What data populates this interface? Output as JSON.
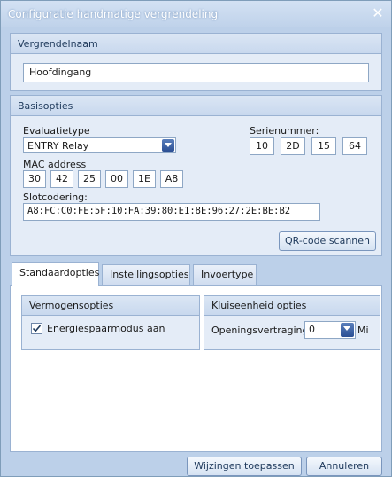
{
  "window": {
    "title": "Configuratie handmatige vergrendeling",
    "close_glyph": "✕"
  },
  "lock_name": {
    "header": "Vergrendelnaam",
    "value": "Hoofdingang"
  },
  "basic": {
    "header": "Basisopties",
    "evaluation_label": "Evaluatietype",
    "evaluation_value": "ENTRY Relay",
    "serial_label": "Serienummer:",
    "serial": [
      "10",
      "2D",
      "15",
      "64"
    ],
    "mac_label": "MAC address",
    "mac": [
      "30",
      "42",
      "25",
      "00",
      "1E",
      "A8"
    ],
    "slot_label": "Slotcodering:",
    "slot_value": "A8:FC:C0:FE:5F:10:FA:39:80:E1:8E:96:27:2E:BE:B2",
    "qr_button": "QR-code scannen"
  },
  "tabs": {
    "standard": "Standaardopties",
    "settings": "Instellingsopties",
    "input": "Invoertype"
  },
  "power": {
    "header": "Vermogensopties",
    "power_saving_label": "Energiespaarmodus aan",
    "power_saving_checked": true
  },
  "vault": {
    "header": "Kluiseenheid opties",
    "delay_label": "Openingsvertraging",
    "delay_value": "0",
    "unit_label": "Mi"
  },
  "footer": {
    "apply": "Wijzingen toepassen",
    "cancel": "Annuleren"
  },
  "colors": {
    "window_bg": "#bcd0e9",
    "group_bg": "#e4ecf7",
    "accent": "#2b4f94"
  }
}
